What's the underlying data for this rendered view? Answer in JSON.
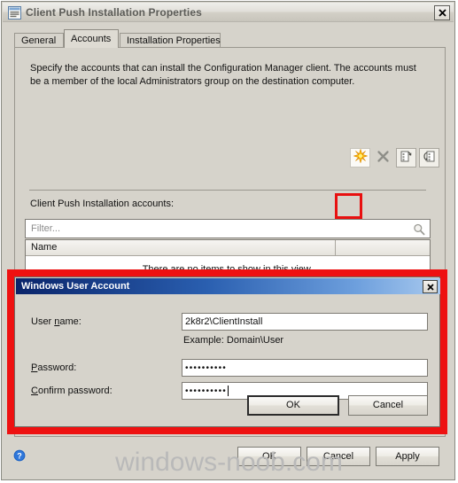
{
  "window": {
    "title": "Client Push Installation Properties",
    "icon": "properties-window-icon",
    "close_label": "✕"
  },
  "tabs": [
    {
      "label": "General",
      "active": false
    },
    {
      "label": "Accounts",
      "active": true
    },
    {
      "label": "Installation Properties",
      "active": false
    }
  ],
  "accounts_tab": {
    "description": "Specify the accounts that can install the Configuration Manager client. The accounts must be a member of the local Administrators group on the destination computer.",
    "accounts_label": "Client Push Installation accounts:",
    "toolbar": {
      "new_icon": "starburst-new-icon",
      "delete_icon": "x-delete-icon",
      "properties_icon": "properties-refresh-icon",
      "copy_icon": "copy-to-icon"
    },
    "filter": {
      "placeholder": "Filter...",
      "value": "",
      "search_icon": "magnifier-icon"
    },
    "list": {
      "columns": [
        "Name",
        ""
      ],
      "empty_message": "There are no items to show in this view."
    }
  },
  "dialog": {
    "title": "Windows User Account",
    "close_label": "✕",
    "fields": {
      "user_name_label": "User name:",
      "user_name_value": "2k8r2\\ClientInstall",
      "user_name_hint": "Example: Domain\\User",
      "password_label": "Password:",
      "password_value": "••••••••••",
      "confirm_label": "Confirm password:",
      "confirm_value": "••••••••••"
    },
    "buttons": {
      "ok": "OK",
      "cancel": "Cancel"
    }
  },
  "footer": {
    "help_icon": "help-question-icon",
    "ok": "OK",
    "cancel": "Cancel",
    "apply": "Apply"
  },
  "watermark": "windows-noob.com",
  "colors": {
    "face": "#d6d3cb",
    "highlight_red": "#ee1111",
    "dialog_title_start": "#0a246a",
    "dialog_title_end": "#a8c9ee",
    "accent_star": "#ffc20e"
  }
}
